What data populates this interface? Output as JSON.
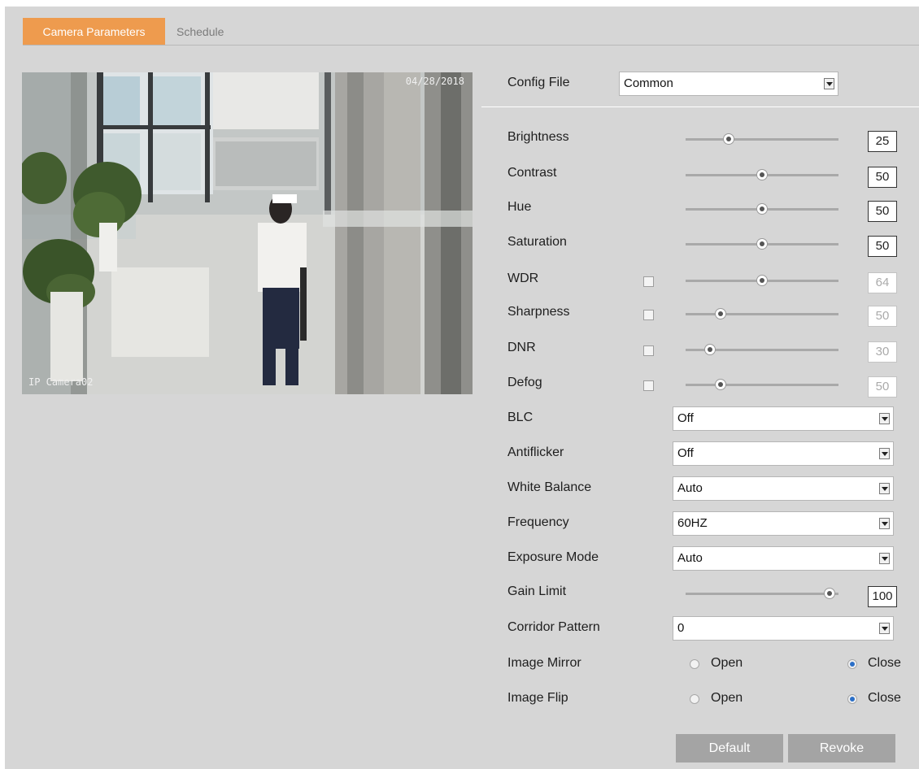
{
  "tabs": {
    "active": "Camera Parameters",
    "inactive": "Schedule"
  },
  "preview": {
    "timestamp": "04/28/2018",
    "camera_name": "IP Camera02"
  },
  "config_file": {
    "label": "Config File",
    "value": "Common"
  },
  "sliders": [
    {
      "label": "Brightness",
      "value": "25",
      "level": 0.28,
      "has_checkbox": false,
      "enabled": true
    },
    {
      "label": "Contrast",
      "value": "50",
      "level": 0.5,
      "has_checkbox": false,
      "enabled": true
    },
    {
      "label": "Hue",
      "value": "50",
      "level": 0.5,
      "has_checkbox": false,
      "enabled": true
    },
    {
      "label": "Saturation",
      "value": "50",
      "level": 0.5,
      "has_checkbox": false,
      "enabled": true
    },
    {
      "label": "WDR",
      "value": "64",
      "level": 0.5,
      "has_checkbox": true,
      "enabled": false
    },
    {
      "label": "Sharpness",
      "value": "50",
      "level": 0.23,
      "has_checkbox": true,
      "enabled": false
    },
    {
      "label": "DNR",
      "value": "30",
      "level": 0.16,
      "has_checkbox": true,
      "enabled": false
    },
    {
      "label": "Defog",
      "value": "50",
      "level": 0.23,
      "has_checkbox": true,
      "enabled": false
    }
  ],
  "selects": [
    {
      "label": "BLC",
      "value": "Off"
    },
    {
      "label": "Antiflicker",
      "value": "Off"
    },
    {
      "label": "White Balance",
      "value": "Auto"
    },
    {
      "label": "Frequency",
      "value": "60HZ"
    },
    {
      "label": "Exposure Mode",
      "value": "Auto"
    }
  ],
  "gain_limit": {
    "label": "Gain Limit",
    "value": "100",
    "level": 0.94
  },
  "corridor_pattern": {
    "label": "Corridor Pattern",
    "value": "0"
  },
  "image_mirror": {
    "label": "Image Mirror",
    "open_label": "Open",
    "close_label": "Close",
    "selected": "Close"
  },
  "image_flip": {
    "label": "Image Flip",
    "open_label": "Open",
    "close_label": "Close",
    "selected": "Close"
  },
  "buttons": {
    "default": "Default",
    "revoke": "Revoke"
  },
  "colors": {
    "accent_tab": "#ee9b4e",
    "panel_bg": "#d6d6d6",
    "button_bg": "#a4a4a4",
    "radio_on": "#2b6fc7"
  }
}
